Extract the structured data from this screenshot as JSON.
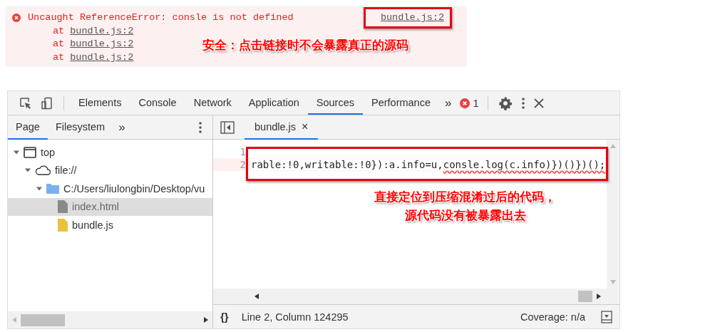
{
  "console_error": {
    "message": "Uncaught ReferenceError: consle is not defined",
    "source_link": "bundle.js:2",
    "stack": [
      {
        "prefix": "at",
        "link": "bundle.js:2"
      },
      {
        "prefix": "at",
        "link": "bundle.js:2"
      },
      {
        "prefix": "at",
        "link": "bundle.js:2"
      }
    ]
  },
  "annotations": [
    {
      "lines": [
        "安全：点击链接时不会暴露真正的源码"
      ]
    },
    {
      "lines": [
        "直接定位到压缩混淆过后的代码，",
        "源代码没有被暴露出去"
      ]
    }
  ],
  "devtools": {
    "tabs": [
      {
        "label": "Elements",
        "selected": false
      },
      {
        "label": "Console",
        "selected": false
      },
      {
        "label": "Network",
        "selected": false
      },
      {
        "label": "Application",
        "selected": false
      },
      {
        "label": "Sources",
        "selected": true
      },
      {
        "label": "Performance",
        "selected": false
      }
    ],
    "more_tabs": "»",
    "error_count": "1",
    "navigator": {
      "tabs": [
        {
          "label": "Page",
          "selected": true
        },
        {
          "label": "Filesystem",
          "selected": false
        }
      ],
      "more_tabs": "»",
      "tree": [
        {
          "kind": "frame",
          "label": "top",
          "expanded": true,
          "children": [
            {
              "kind": "cloud",
              "label": "file://",
              "expanded": true,
              "children": [
                {
                  "kind": "folder",
                  "label": "C:/Users/liulongbin/Desktop/vu",
                  "expanded": true,
                  "children": [
                    {
                      "kind": "file",
                      "label": "index.html",
                      "selected": true
                    },
                    {
                      "kind": "script",
                      "label": "bundle.js",
                      "selected": false
                    }
                  ]
                }
              ]
            }
          ]
        }
      ]
    },
    "editor": {
      "tab": {
        "label": "bundle.js",
        "close": "×",
        "selected": true
      },
      "lines": [
        {
          "number": "1",
          "highlighted": false
        },
        {
          "number": "2",
          "highlighted": true,
          "segments": [
            {
              "text": "rable:!0,writable:!0}):a.info=u,",
              "error": false
            },
            {
              "text": "consle.log(c.info)})()})();",
              "error": true
            }
          ]
        }
      ]
    },
    "status_bar": {
      "format_button": "{}",
      "position": "Line 2, Column 124295",
      "coverage": "Coverage: n/a"
    }
  }
}
